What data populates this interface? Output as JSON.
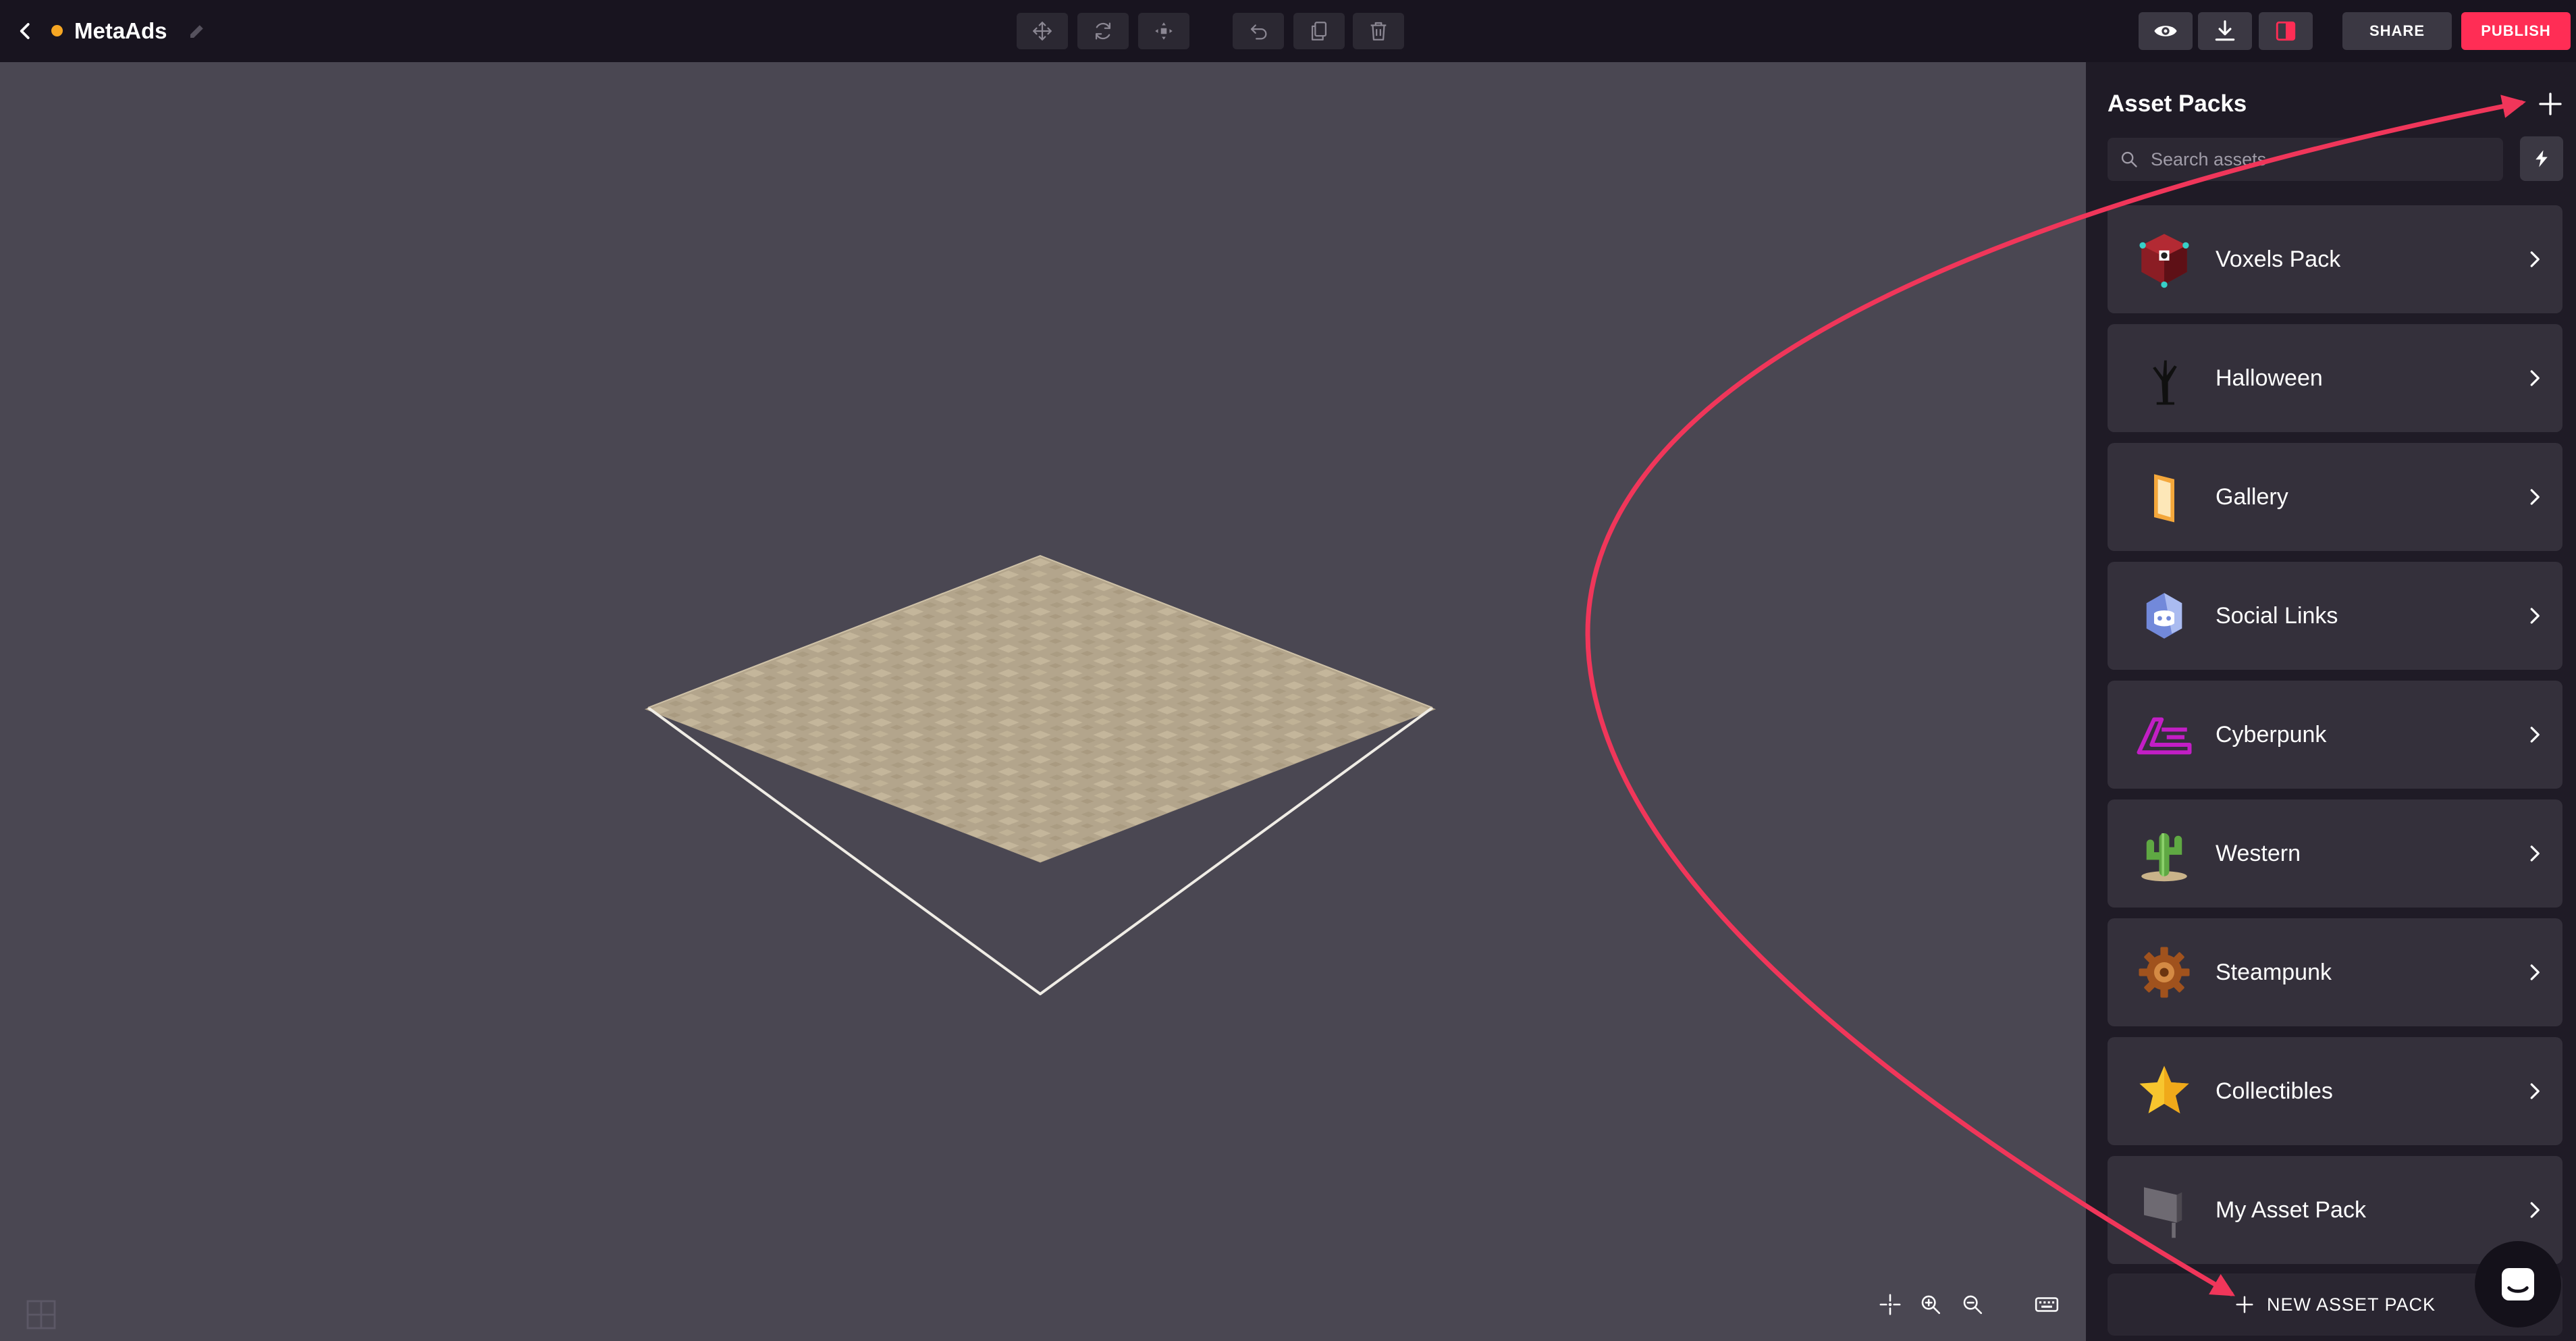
{
  "header": {
    "project_title": "MetaAds",
    "share_label": "SHARE",
    "publish_label": "PUBLISH"
  },
  "toolbar": {
    "tools": [
      "move-icon",
      "rotate-icon",
      "scale-icon",
      "undo-icon",
      "duplicate-icon",
      "delete-icon"
    ],
    "right_tools": [
      "preview-eye-icon",
      "download-icon",
      "toggle-sidebar-icon"
    ]
  },
  "sidebar": {
    "title": "Asset Packs",
    "search": {
      "placeholder": "Search assets",
      "value": ""
    },
    "packs": [
      {
        "label": "Voxels Pack"
      },
      {
        "label": "Halloween"
      },
      {
        "label": "Gallery"
      },
      {
        "label": "Social Links"
      },
      {
        "label": "Cyberpunk"
      },
      {
        "label": "Western"
      },
      {
        "label": "Steampunk"
      },
      {
        "label": "Collectibles"
      },
      {
        "label": "My Asset Pack"
      }
    ],
    "new_pack_label": "NEW ASSET PACK"
  },
  "viewport": {
    "bottom_tools": [
      "center-camera-icon",
      "zoom-in-icon",
      "zoom-out-icon",
      "keyboard-shortcuts-icon"
    ]
  },
  "colors": {
    "topbar_bg": "#18141f",
    "viewport_bg": "#4a4752",
    "sidebar_bg": "#1f1b26",
    "pack_item_bg": "#34303b",
    "publish_accent": "#ff2d55",
    "unsaved_dot": "#f5a623",
    "annotation_arrow": "#f0365a",
    "ground_tile": "#b3a58c"
  }
}
